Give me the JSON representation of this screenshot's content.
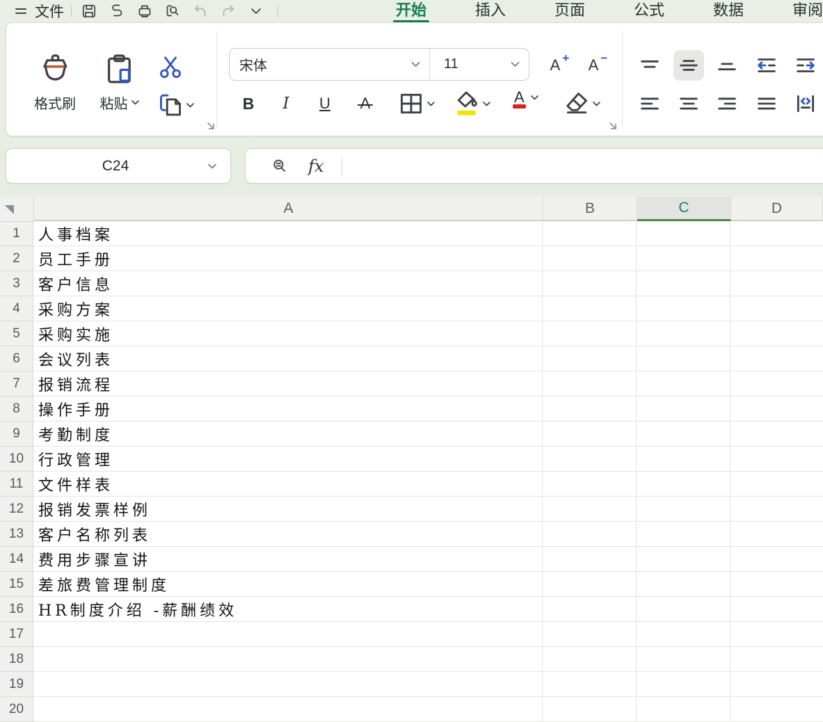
{
  "tabbar": {
    "menu": "文件",
    "active_tab": "开始",
    "tabs": [
      {
        "label": "开始"
      },
      {
        "label": "插入"
      },
      {
        "label": "页面"
      },
      {
        "label": "公式"
      },
      {
        "label": "数据"
      },
      {
        "label": "审阅"
      }
    ],
    "quick_icons": [
      "save-icon",
      "export-icon",
      "print-icon",
      "find-icon",
      "undo-icon",
      "redo-icon",
      "chevron-down-icon"
    ]
  },
  "ribbon": {
    "format_painter_label": "格式刷",
    "paste_label": "粘贴",
    "font_family": "宋体",
    "font_size": "11",
    "bold_label": "B",
    "italic_label": "I",
    "underline_label": "U",
    "strikethrough_label": "A",
    "grow_font_label": "A",
    "shrink_font_label": "A",
    "font_color_label": "A",
    "icons": [
      "format-painter-icon",
      "paste-icon",
      "cut-icon",
      "copy-icon",
      "borders-icon",
      "fill-color-icon",
      "font-color-icon",
      "eraser-icon",
      "align-top-icon",
      "align-middle-icon",
      "align-bottom-icon",
      "decrease-indent-icon",
      "increase-indent-icon",
      "align-left-icon",
      "align-center-icon",
      "align-right-icon",
      "justify-icon",
      "wrap-text-icon"
    ],
    "selected_align": "align-middle"
  },
  "formula_bar": {
    "cell_reference": "C24",
    "fx_label": "fx",
    "formula_value": ""
  },
  "grid": {
    "columns": [
      "A",
      "B",
      "C",
      "D"
    ],
    "selected_column": "C",
    "rows": [
      {
        "n": "1",
        "a": "人事档案"
      },
      {
        "n": "2",
        "a": "员工手册"
      },
      {
        "n": "3",
        "a": "客户信息"
      },
      {
        "n": "4",
        "a": "采购方案"
      },
      {
        "n": "5",
        "a": "采购实施"
      },
      {
        "n": "6",
        "a": "会议列表"
      },
      {
        "n": "7",
        "a": "报销流程"
      },
      {
        "n": "8",
        "a": "操作手册"
      },
      {
        "n": "9",
        "a": "考勤制度"
      },
      {
        "n": "10",
        "a": "行政管理"
      },
      {
        "n": "11",
        "a": "文件样表"
      },
      {
        "n": "12",
        "a": "报销发票样例"
      },
      {
        "n": "13",
        "a": "客户名称列表"
      },
      {
        "n": "14",
        "a": "费用步骤宣讲"
      },
      {
        "n": "15",
        "a": "差旅费管理制度"
      },
      {
        "n": "16",
        "a": "HR制度介绍 -薪酬绩效"
      },
      {
        "n": "17",
        "a": ""
      },
      {
        "n": "18",
        "a": ""
      },
      {
        "n": "19",
        "a": ""
      },
      {
        "n": "20",
        "a": ""
      }
    ]
  },
  "colors": {
    "accent_green": "#177c55",
    "selected_column_text": "#1b7a68",
    "selected_column_underline": "#478c42",
    "accent_blue": "#2e56c4",
    "fill_yellow": "#f3e20a",
    "font_red": "#e01e1e",
    "brush_orange": "#c05a28"
  }
}
